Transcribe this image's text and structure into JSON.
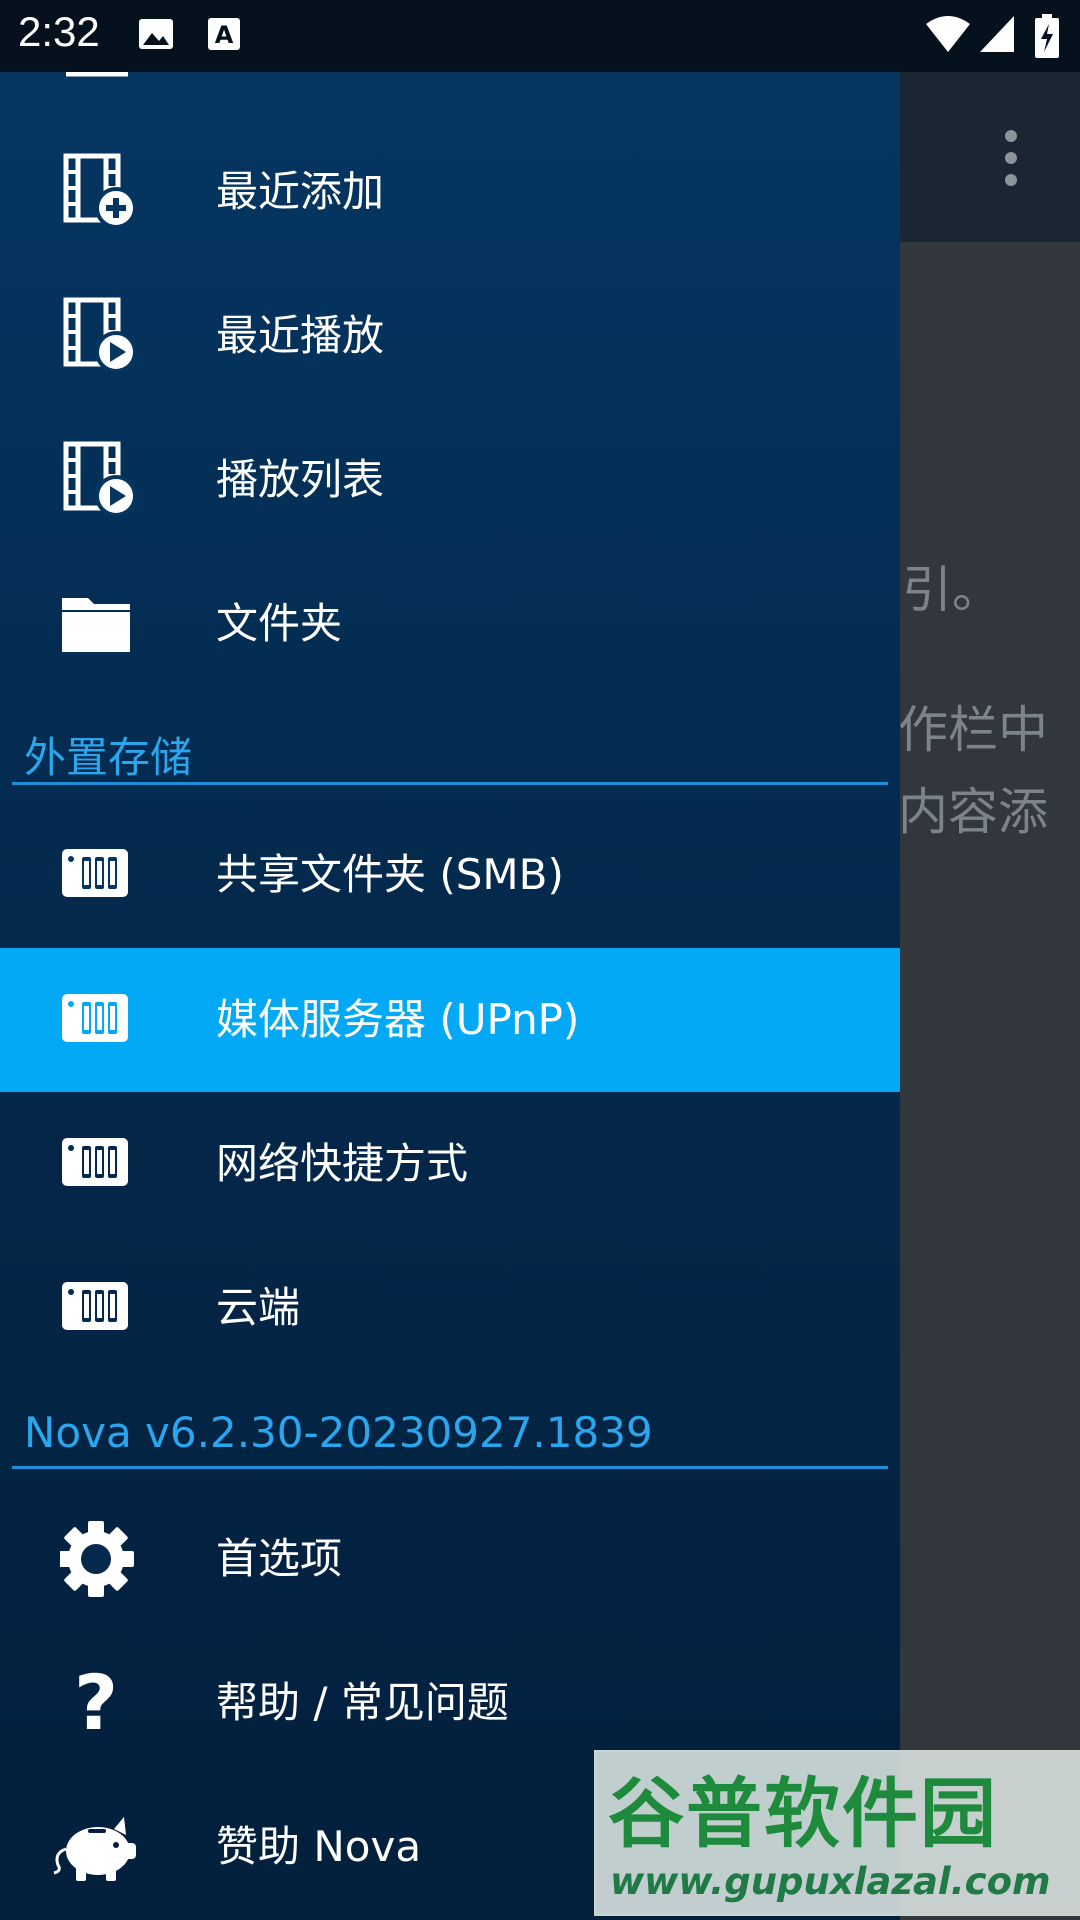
{
  "status_bar": {
    "time": "2:32",
    "icons": [
      "image-icon",
      "text-a-icon",
      "wifi-icon",
      "signal-icon",
      "battery-charging-icon"
    ]
  },
  "background": {
    "overflow_icon": "more-vert-icon",
    "text_fragments": [
      "引。",
      "作栏中",
      "内容添"
    ]
  },
  "drawer": {
    "items_top": [
      {
        "label": "最近添加",
        "icon": "film-add-icon"
      },
      {
        "label": "最近播放",
        "icon": "film-play-icon"
      },
      {
        "label": "播放列表",
        "icon": "film-play-icon"
      },
      {
        "label": "文件夹",
        "icon": "folder-icon"
      }
    ],
    "external_header": "外置存储",
    "items_external": [
      {
        "label": "共享文件夹 (SMB)",
        "icon": "server-icon"
      },
      {
        "label": "媒体服务器 (UPnP)",
        "icon": "server-icon",
        "selected": true
      },
      {
        "label": "网络快捷方式",
        "icon": "server-icon"
      },
      {
        "label": "云端",
        "icon": "server-icon"
      }
    ],
    "version_header": "Nova v6.2.30-20230927.1839",
    "items_bottom": [
      {
        "label": "首选项",
        "icon": "gear-icon"
      },
      {
        "label": "帮助 / 常见问题",
        "icon": "help-icon"
      },
      {
        "label": "赞助 Nova",
        "icon": "piggy-bank-icon"
      }
    ]
  },
  "watermark": {
    "title": "谷普软件园",
    "url": "www.gupuxlazal.com"
  },
  "colors": {
    "drawer_top": "#053662",
    "drawer_bottom": "#031f3c",
    "accent": "#03a9f4",
    "header_text": "#2aa6ee",
    "status_bar": "#05111c"
  }
}
